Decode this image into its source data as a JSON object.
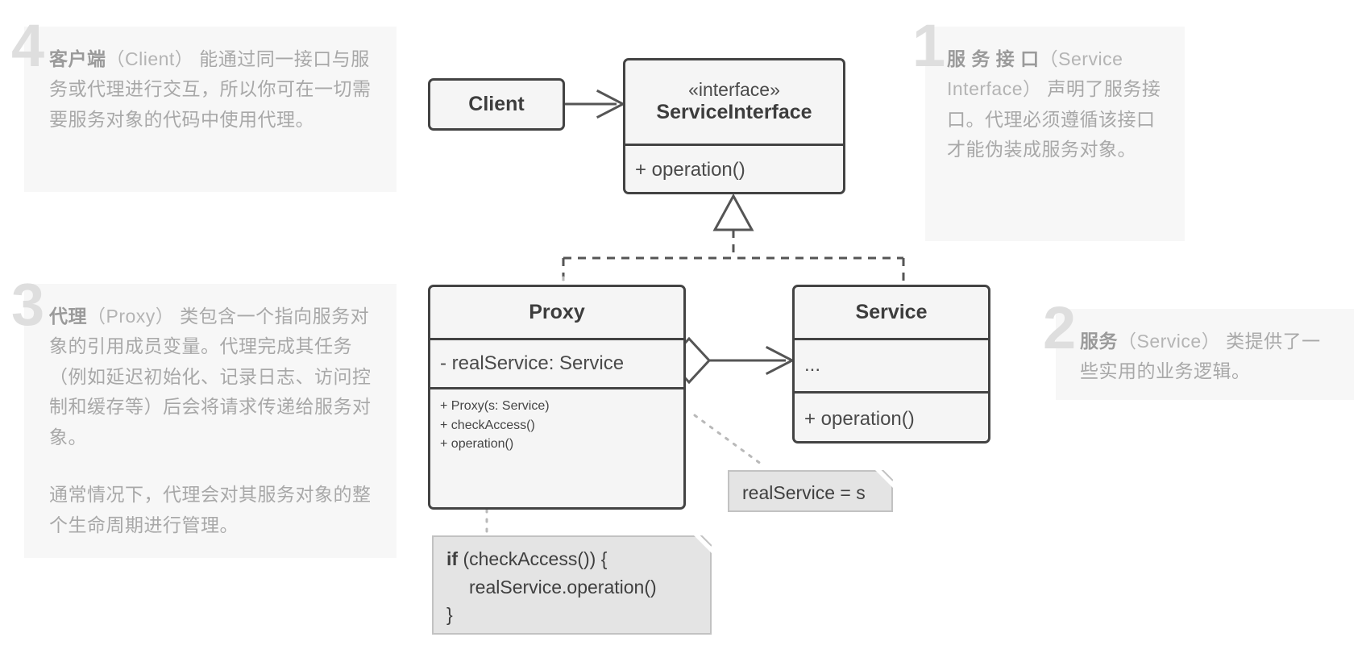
{
  "diagram": {
    "title": "Proxy Design Pattern UML Class Diagram",
    "colors": {
      "box_border": "#434343",
      "box_fill": "#f5f5f5",
      "note_fill": "#e4e4e4",
      "note_border": "#c2c2c2",
      "panel_bg": "#f7f7f7",
      "panel_text": "#a8a8a8",
      "panel_number": "#dedede",
      "connector": "#555555"
    }
  },
  "classes": {
    "client": {
      "name": "Client"
    },
    "service_interface": {
      "stereotype": "«interface»",
      "name": "ServiceInterface",
      "operations": [
        "+ operation()"
      ]
    },
    "proxy": {
      "name": "Proxy",
      "attributes": [
        "- realService: Service"
      ],
      "operations": [
        "+ Proxy(s: Service)",
        "+ checkAccess()",
        "+ operation()"
      ]
    },
    "service": {
      "name": "Service",
      "attributes": [
        "..."
      ],
      "operations": [
        "+ operation()"
      ]
    }
  },
  "notes": {
    "assignment": {
      "text": "realService = s"
    },
    "code": {
      "line1_bold": "if",
      "line1_rest": " (checkAccess()) {",
      "line2": "realService.operation()",
      "line3": "}"
    }
  },
  "annotations": [
    {
      "number": "1",
      "position": "top-right",
      "term": "服 务 接 口",
      "latin": "（Service Interface）",
      "body": " 声明了服务接口。代理必须遵循该接口才能伪装成服务对象。"
    },
    {
      "number": "2",
      "position": "middle-right",
      "term": "服务",
      "latin": "（Service）",
      "body": " 类提供了一些实用的业务逻辑。"
    },
    {
      "number": "3",
      "position": "middle-left",
      "term": "代理",
      "latin": "（Proxy）",
      "body": " 类包含一个指向服务对象的引用成员变量。代理完成其任务（例如延迟初始化、记录日志、访问控制和缓存等）后会将请求传递给服务对象。",
      "body2": "通常情况下，代理会对其服务对象的整个生命周期进行管理。"
    },
    {
      "number": "4",
      "position": "top-left",
      "term": "客户端",
      "latin": "（Client）",
      "body": " 能通过同一接口与服务或代理进行交互，所以你可在一切需要服务对象的代码中使用代理。"
    }
  ],
  "relationships": [
    {
      "type": "association",
      "from": "Client",
      "to": "ServiceInterface",
      "arrow": "open-arrow"
    },
    {
      "type": "realization",
      "from": "Proxy",
      "to": "ServiceInterface",
      "arrow": "hollow-triangle",
      "line": "dashed"
    },
    {
      "type": "realization",
      "from": "Service",
      "to": "ServiceInterface",
      "arrow": "hollow-triangle",
      "line": "dashed"
    },
    {
      "type": "aggregation",
      "from": "Proxy",
      "to": "Service",
      "arrow": "hollow-diamond-open-arrow"
    },
    {
      "type": "note-link",
      "from": "Proxy",
      "to": "realService = s",
      "line": "dotted"
    },
    {
      "type": "note-link",
      "from": "Proxy",
      "to": "code-note",
      "line": "dotted"
    }
  ]
}
